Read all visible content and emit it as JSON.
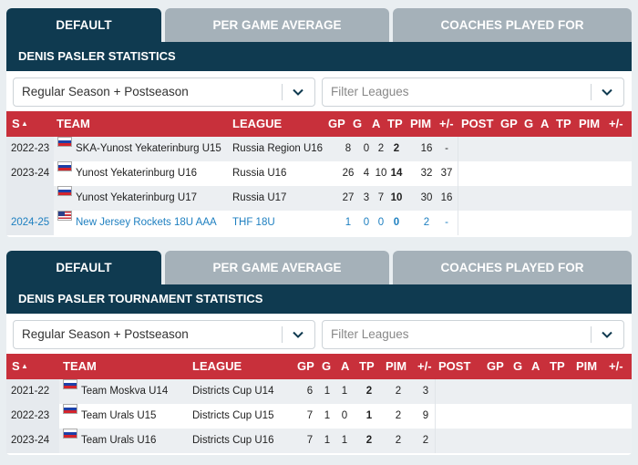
{
  "tabs": [
    "DEFAULT",
    "PER GAME AVERAGE",
    "COACHES PLAYED FOR"
  ],
  "stats": {
    "title": "DENIS PASLER STATISTICS",
    "filter_value": "Regular Season + Postseason",
    "leagues_placeholder": "Filter Leagues",
    "headers": {
      "season": "S",
      "sort": "▲",
      "team": "TEAM",
      "league": "LEAGUE",
      "gp": "GP",
      "g": "G",
      "a": "A",
      "tp": "TP",
      "pim": "PIM",
      "pm": "+/-",
      "post": "POST",
      "pgp": "GP",
      "pg": "G",
      "pa": "A",
      "ptp": "TP",
      "ppim": "PIM",
      "ppm": "+/-"
    },
    "rows": [
      {
        "season": "2022-23",
        "flag": "russia",
        "team": "SKA-Yunost Yekaterinburg U15",
        "league": "Russia Region U16",
        "gp": "8",
        "g": "0",
        "a": "2",
        "tp": "2",
        "pim": "16",
        "pm": "-"
      },
      {
        "season": "2023-24",
        "flag": "russia",
        "team": "Yunost Yekaterinburg U16",
        "league": "Russia U16",
        "gp": "26",
        "g": "4",
        "a": "10",
        "tp": "14",
        "pim": "32",
        "pm": "37"
      },
      {
        "season": "",
        "flag": "russia",
        "team": "Yunost Yekaterinburg U17",
        "league": "Russia U17",
        "gp": "27",
        "g": "3",
        "a": "7",
        "tp": "10",
        "pim": "30",
        "pm": "16"
      },
      {
        "season": "2024-25",
        "flag": "usa",
        "team": "New Jersey Rockets 18U AAA",
        "league": "THF 18U",
        "gp": "1",
        "g": "0",
        "a": "0",
        "tp": "0",
        "pim": "2",
        "pm": "-"
      }
    ]
  },
  "tournament": {
    "title": "DENIS PASLER TOURNAMENT STATISTICS",
    "filter_value": "Regular Season + Postseason",
    "leagues_placeholder": "Filter Leagues",
    "headers": {
      "season": "S",
      "sort": "▲",
      "team": "TEAM",
      "league": "LEAGUE",
      "gp": "GP",
      "g": "G",
      "a": "A",
      "tp": "TP",
      "pim": "PIM",
      "pm": "+/-",
      "post": "POST",
      "pgp": "GP",
      "pg": "G",
      "pa": "A",
      "ptp": "TP",
      "ppim": "PIM",
      "ppm": "+/-"
    },
    "rows": [
      {
        "season": "2021-22",
        "flag": "russia",
        "team": "Team Moskva U14",
        "league": "Districts Cup U14",
        "gp": "6",
        "g": "1",
        "a": "1",
        "tp": "2",
        "pim": "2",
        "pm": "3"
      },
      {
        "season": "2022-23",
        "flag": "russia",
        "team": "Team Urals U15",
        "league": "Districts Cup U15",
        "gp": "7",
        "g": "1",
        "a": "0",
        "tp": "1",
        "pim": "2",
        "pm": "9"
      },
      {
        "season": "2023-24",
        "flag": "russia",
        "team": "Team Urals U16",
        "league": "Districts Cup U16",
        "gp": "7",
        "g": "1",
        "a": "1",
        "tp": "2",
        "pim": "2",
        "pm": "2"
      }
    ]
  },
  "colors": {
    "navy": "#0f3a50",
    "red": "#c8303b",
    "tab_inactive": "#a5b1b9",
    "link": "#1d7fc0"
  }
}
